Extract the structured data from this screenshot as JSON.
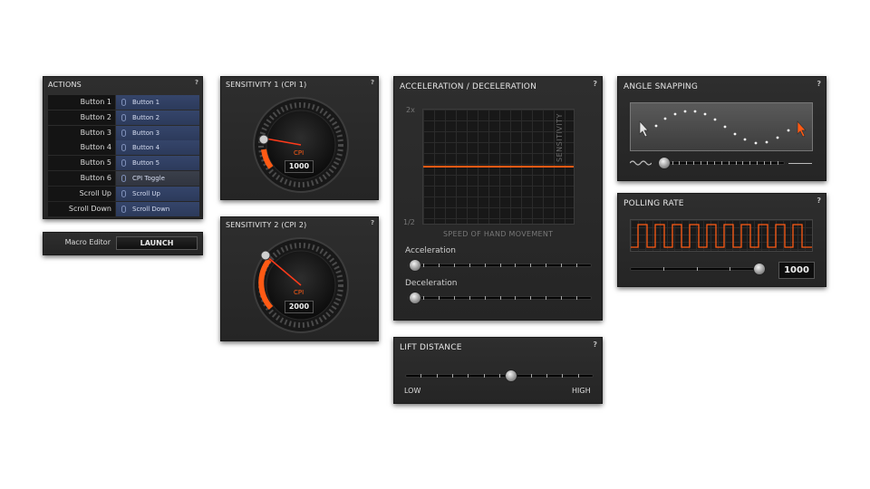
{
  "actions": {
    "title": "ACTIONS",
    "help": "?",
    "rows": [
      {
        "label": "Button 1",
        "value": "Button 1"
      },
      {
        "label": "Button 2",
        "value": "Button 2"
      },
      {
        "label": "Button 3",
        "value": "Button 3"
      },
      {
        "label": "Button 4",
        "value": "Button 4"
      },
      {
        "label": "Button 5",
        "value": "Button 5"
      },
      {
        "label": "Button 6",
        "value": "CPI Toggle"
      },
      {
        "label": "Scroll Up",
        "value": "Scroll Up"
      },
      {
        "label": "Scroll Down",
        "value": "Scroll Down"
      }
    ]
  },
  "macro": {
    "label": "Macro Editor",
    "button": "LAUNCH"
  },
  "sensitivity1": {
    "title": "SENSITIVITY 1 (CPI 1)",
    "help": "?",
    "unit": "CPI",
    "value": "1000"
  },
  "sensitivity2": {
    "title": "SENSITIVITY 2 (CPI 2)",
    "help": "?",
    "unit": "CPI",
    "value": "2000"
  },
  "accel": {
    "title": "ACCELERATION / DECELERATION",
    "help": "?",
    "y_top": "2x",
    "y_bottom": "1/2",
    "x_label": "SPEED OF HAND MOVEMENT",
    "y_label": "SENSITIVITY",
    "acceleration_label": "Acceleration",
    "deceleration_label": "Deceleration"
  },
  "lift": {
    "title": "LIFT DISTANCE",
    "help": "?",
    "low": "LOW",
    "high": "HIGH"
  },
  "angle": {
    "title": "ANGLE SNAPPING",
    "help": "?"
  },
  "polling": {
    "title": "POLLING RATE",
    "help": "?",
    "value": "1000"
  },
  "colors": {
    "accent": "#ff5a14",
    "value_blue": "#2c3a5b"
  }
}
